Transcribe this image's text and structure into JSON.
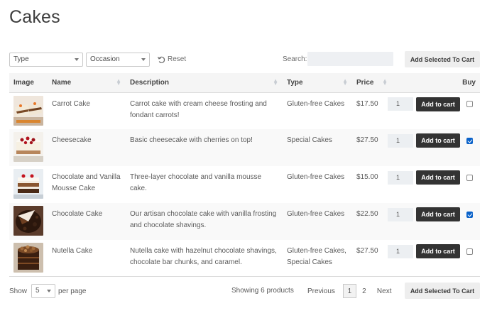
{
  "page": {
    "title": "Cakes"
  },
  "filters": {
    "type_label": "Type",
    "occasion_label": "Occasion",
    "reset_label": "Reset",
    "search_label": "Search:",
    "search_value": ""
  },
  "actions": {
    "add_selected_label": "Add Selected To Cart"
  },
  "table": {
    "headers": {
      "image": "Image",
      "name": "Name",
      "description": "Description",
      "type": "Type",
      "price": "Price",
      "buy": "Buy"
    },
    "rows": [
      {
        "name": "Carrot Cake",
        "description": "Carrot cake with cream cheese frosting and fondant carrots!",
        "type": "Gluten-free Cakes",
        "price": "$17.50",
        "qty": "1",
        "add_label": "Add to cart",
        "checked": false,
        "image_icon": "carrot-cake-photo"
      },
      {
        "name": "Cheesecake",
        "description": "Basic cheesecake with cherries on top!",
        "type": "Special Cakes",
        "price": "$27.50",
        "qty": "1",
        "add_label": "Add to cart",
        "checked": true,
        "image_icon": "cheesecake-photo"
      },
      {
        "name": "Chocolate and Vanilla Mousse Cake",
        "description": "Three-layer chocolate and vanilla mousse cake.",
        "type": "Gluten-free Cakes",
        "price": "$15.00",
        "qty": "1",
        "add_label": "Add to cart",
        "checked": false,
        "image_icon": "mousse-cake-photo"
      },
      {
        "name": "Chocolate Cake",
        "description": "Our artisan chocolate cake with vanilla frosting and chocolate shavings.",
        "type": "Gluten-free Cakes",
        "price": "$22.50",
        "qty": "1",
        "add_label": "Add to cart",
        "checked": true,
        "image_icon": "chocolate-cake-photo"
      },
      {
        "name": "Nutella Cake",
        "description": "Nutella cake with hazelnut chocolate shavings, chocolate bar chunks, and caramel.",
        "type": "Gluten-free Cakes, Special Cakes",
        "price": "$27.50",
        "qty": "1",
        "add_label": "Add to cart",
        "checked": false,
        "image_icon": "nutella-cake-photo"
      }
    ]
  },
  "footer": {
    "show_label": "Show",
    "per_page_value": "5",
    "per_page_label": "per page",
    "showing_text": "Showing 6 products",
    "previous_label": "Previous",
    "current_page": "1",
    "page_2": "2",
    "next_label": "Next"
  },
  "colors": {
    "add_to_cart_bg": "#333333",
    "checkbox_checked": "#0a62c9",
    "header_bg": "#f5f5f5"
  }
}
